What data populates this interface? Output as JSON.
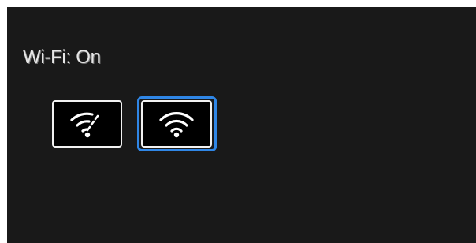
{
  "wifi": {
    "status_label": "Wi-Fi: On",
    "options": [
      {
        "icon": "wifi-off-icon",
        "selected": false
      },
      {
        "icon": "wifi-icon",
        "selected": true
      }
    ]
  },
  "colors": {
    "panel_background": "#191919",
    "selection_ring": "#2f86e6",
    "button_border": "#f2f2f2",
    "text": "#e6e6e6"
  }
}
